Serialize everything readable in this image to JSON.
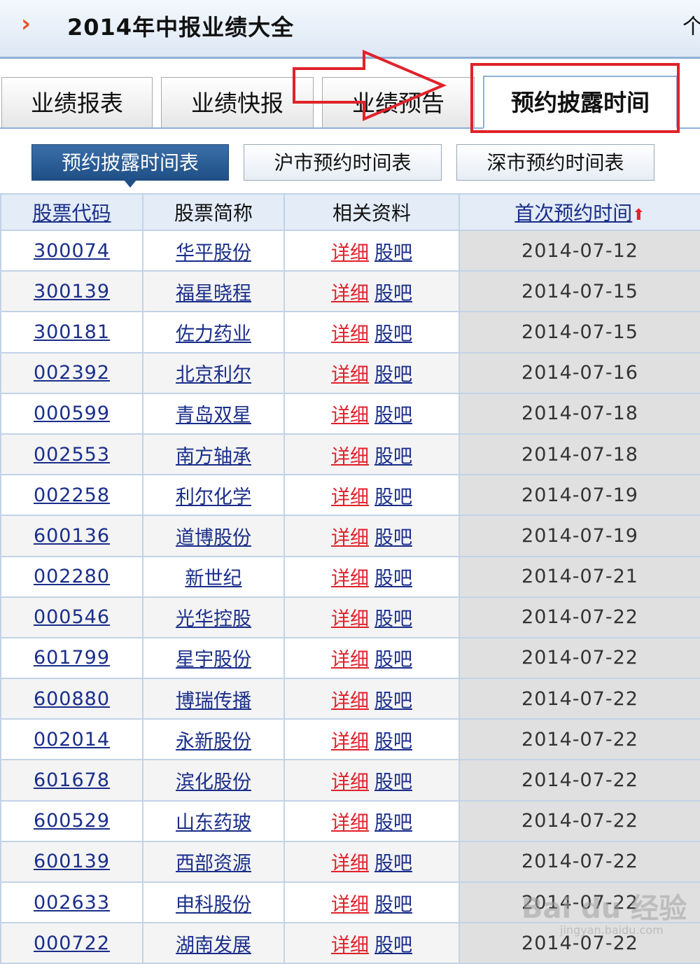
{
  "header": {
    "chevron": "›",
    "title": "2014年中报业绩大全",
    "more": "个"
  },
  "tabs": [
    {
      "label": "业绩报表"
    },
    {
      "label": "业绩快报"
    },
    {
      "label": "业绩预告"
    },
    {
      "label": "预约披露时间",
      "active": true
    }
  ],
  "subtabs": [
    {
      "label": "预约披露时间表",
      "active": true
    },
    {
      "label": "沪市预约时间表"
    },
    {
      "label": "深市预约时间表"
    }
  ],
  "table": {
    "headers": {
      "code": "股票代码",
      "name": "股票简称",
      "related": "相关资料",
      "date": "首次预约时间"
    },
    "detail_label": "详细",
    "bar_label": "股吧",
    "rows": [
      {
        "code": "300074",
        "name": "华平股份",
        "date": "2014-07-12"
      },
      {
        "code": "300139",
        "name": "福星晓程",
        "date": "2014-07-15"
      },
      {
        "code": "300181",
        "name": "佐力药业",
        "date": "2014-07-15"
      },
      {
        "code": "002392",
        "name": "北京利尔",
        "date": "2014-07-16"
      },
      {
        "code": "000599",
        "name": "青岛双星",
        "date": "2014-07-18"
      },
      {
        "code": "002553",
        "name": "南方轴承",
        "date": "2014-07-18"
      },
      {
        "code": "002258",
        "name": "利尔化学",
        "date": "2014-07-19"
      },
      {
        "code": "600136",
        "name": "道博股份",
        "date": "2014-07-19"
      },
      {
        "code": "002280",
        "name": "新世纪",
        "date": "2014-07-21"
      },
      {
        "code": "000546",
        "name": "光华控股",
        "date": "2014-07-22"
      },
      {
        "code": "601799",
        "name": "星宇股份",
        "date": "2014-07-22"
      },
      {
        "code": "600880",
        "name": "博瑞传播",
        "date": "2014-07-22"
      },
      {
        "code": "002014",
        "name": "永新股份",
        "date": "2014-07-22"
      },
      {
        "code": "601678",
        "name": "滨化股份",
        "date": "2014-07-22"
      },
      {
        "code": "600529",
        "name": "山东药玻",
        "date": "2014-07-22"
      },
      {
        "code": "600139",
        "name": "西部资源",
        "date": "2014-07-22"
      },
      {
        "code": "002633",
        "name": "申科股份",
        "date": "2014-07-22"
      },
      {
        "code": "000722",
        "name": "湖南发展",
        "date": "2014-07-22"
      }
    ]
  },
  "watermark": {
    "text": "Bai du 经验",
    "sub": "jingyan.baidu.com"
  },
  "colors": {
    "accent_red": "#e0222a",
    "link_blue": "#1a2e8a",
    "active_button": "#1f4f86"
  }
}
